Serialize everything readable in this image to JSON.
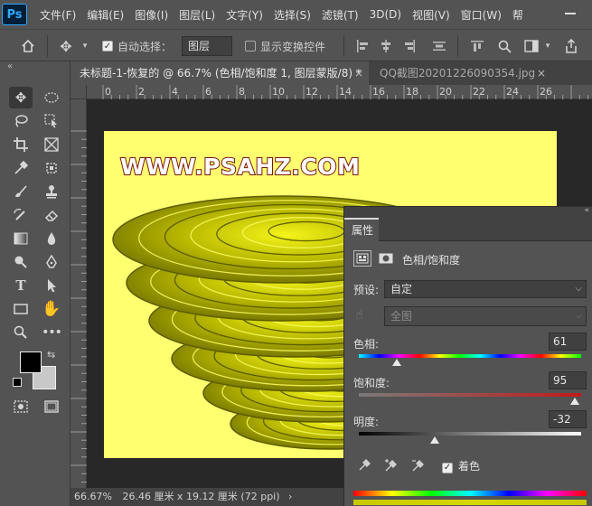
{
  "app": {
    "logo": "Ps"
  },
  "menu": [
    "文件(F)",
    "编辑(E)",
    "图像(I)",
    "图层(L)",
    "文字(Y)",
    "选择(S)",
    "滤镜(T)",
    "3D(D)",
    "视图(V)",
    "窗口(W)",
    "帮"
  ],
  "options": {
    "auto_select_label": "自动选择：",
    "auto_select_checked": true,
    "auto_select_target": "图层",
    "show_transform_label": "显示变换控件",
    "show_transform_checked": false
  },
  "tabs": [
    {
      "label": "未标题-1-恢复的 @ 66.7% (色相/饱和度 1, 图层蒙版/8) *",
      "active": true,
      "close": "×"
    },
    {
      "label": "QQ截图20201226090354.jpg",
      "active": false,
      "close": "×"
    }
  ],
  "ruler": {
    "top_ticks": [
      "0",
      "2",
      "4",
      "6",
      "8",
      "10",
      "12",
      "14",
      "16",
      "18",
      "20",
      "22",
      "24",
      "26"
    ]
  },
  "canvas": {
    "background": "#ffff6f",
    "watermark": "WWW.PSAHZ.COM"
  },
  "status": {
    "zoom": "66.67%",
    "doc_size": "26.46 厘米 x 19.12 厘米 (72 ppi)",
    "arrow": "›"
  },
  "properties": {
    "tab_label": "属性",
    "adjustment_title": "色相/饱和度",
    "preset_label": "预设:",
    "preset_value": "自定",
    "channel_value": "全图",
    "hue_label": "色相:",
    "hue_value": "61",
    "hue_fraction": 0.17,
    "saturation_label": "饱和度:",
    "saturation_value": "95",
    "saturation_fraction": 0.97,
    "lightness_label": "明度:",
    "lightness_value": "-32",
    "lightness_fraction": 0.34,
    "colorize_label": "着色",
    "colorize_checked": true
  },
  "colors": {
    "foreground": "#000000",
    "background": "#c8c8c8",
    "accent": "#31a8ff"
  }
}
